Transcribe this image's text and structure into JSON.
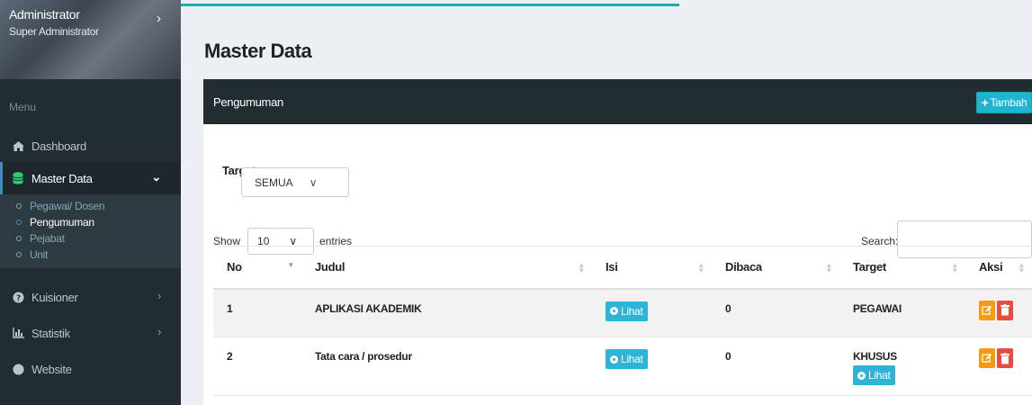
{
  "sidebar": {
    "user_name": "Administrator",
    "user_role": "Super Administrator",
    "menu_header": "Menu",
    "items": [
      {
        "label": "Dashboard"
      },
      {
        "label": "Master Data"
      },
      {
        "label": "Kuisioner"
      },
      {
        "label": "Statistik"
      },
      {
        "label": "Website"
      }
    ],
    "submenu": [
      {
        "label": "Pegawai/ Dosen"
      },
      {
        "label": "Pengumuman"
      },
      {
        "label": "Pejabat"
      },
      {
        "label": "Unit"
      }
    ]
  },
  "main": {
    "page_title": "Master Data",
    "box_title": "Pengumuman",
    "add_button": "Tambah",
    "target_label": "Target",
    "target_value": "SEMUA",
    "show_label": "Show",
    "entries_value": "10",
    "entries_label": "entries",
    "search_label": "Search:",
    "table": {
      "headers": [
        "No",
        "Judul",
        "Isi",
        "Dibaca",
        "Target",
        "Aksi"
      ],
      "rows": [
        {
          "no": "1",
          "judul": "APLIKASI AKADEMIK",
          "isi": "Lihat",
          "dibaca": "0",
          "target": "PEGAWAI"
        },
        {
          "no": "2",
          "judul": "Tata cara / prosedur",
          "isi": "Lihat",
          "dibaca": "0",
          "target": "KHUSUS",
          "target_link": "Lihat"
        }
      ]
    }
  },
  "colors": {
    "sidebar_bg": "#222d32",
    "accent": "#3c8dbc",
    "info_button": "#2eb4d6",
    "edit_button": "#f39c12",
    "delete_button": "#e74c3c",
    "progress_line": "#19b0a5"
  }
}
